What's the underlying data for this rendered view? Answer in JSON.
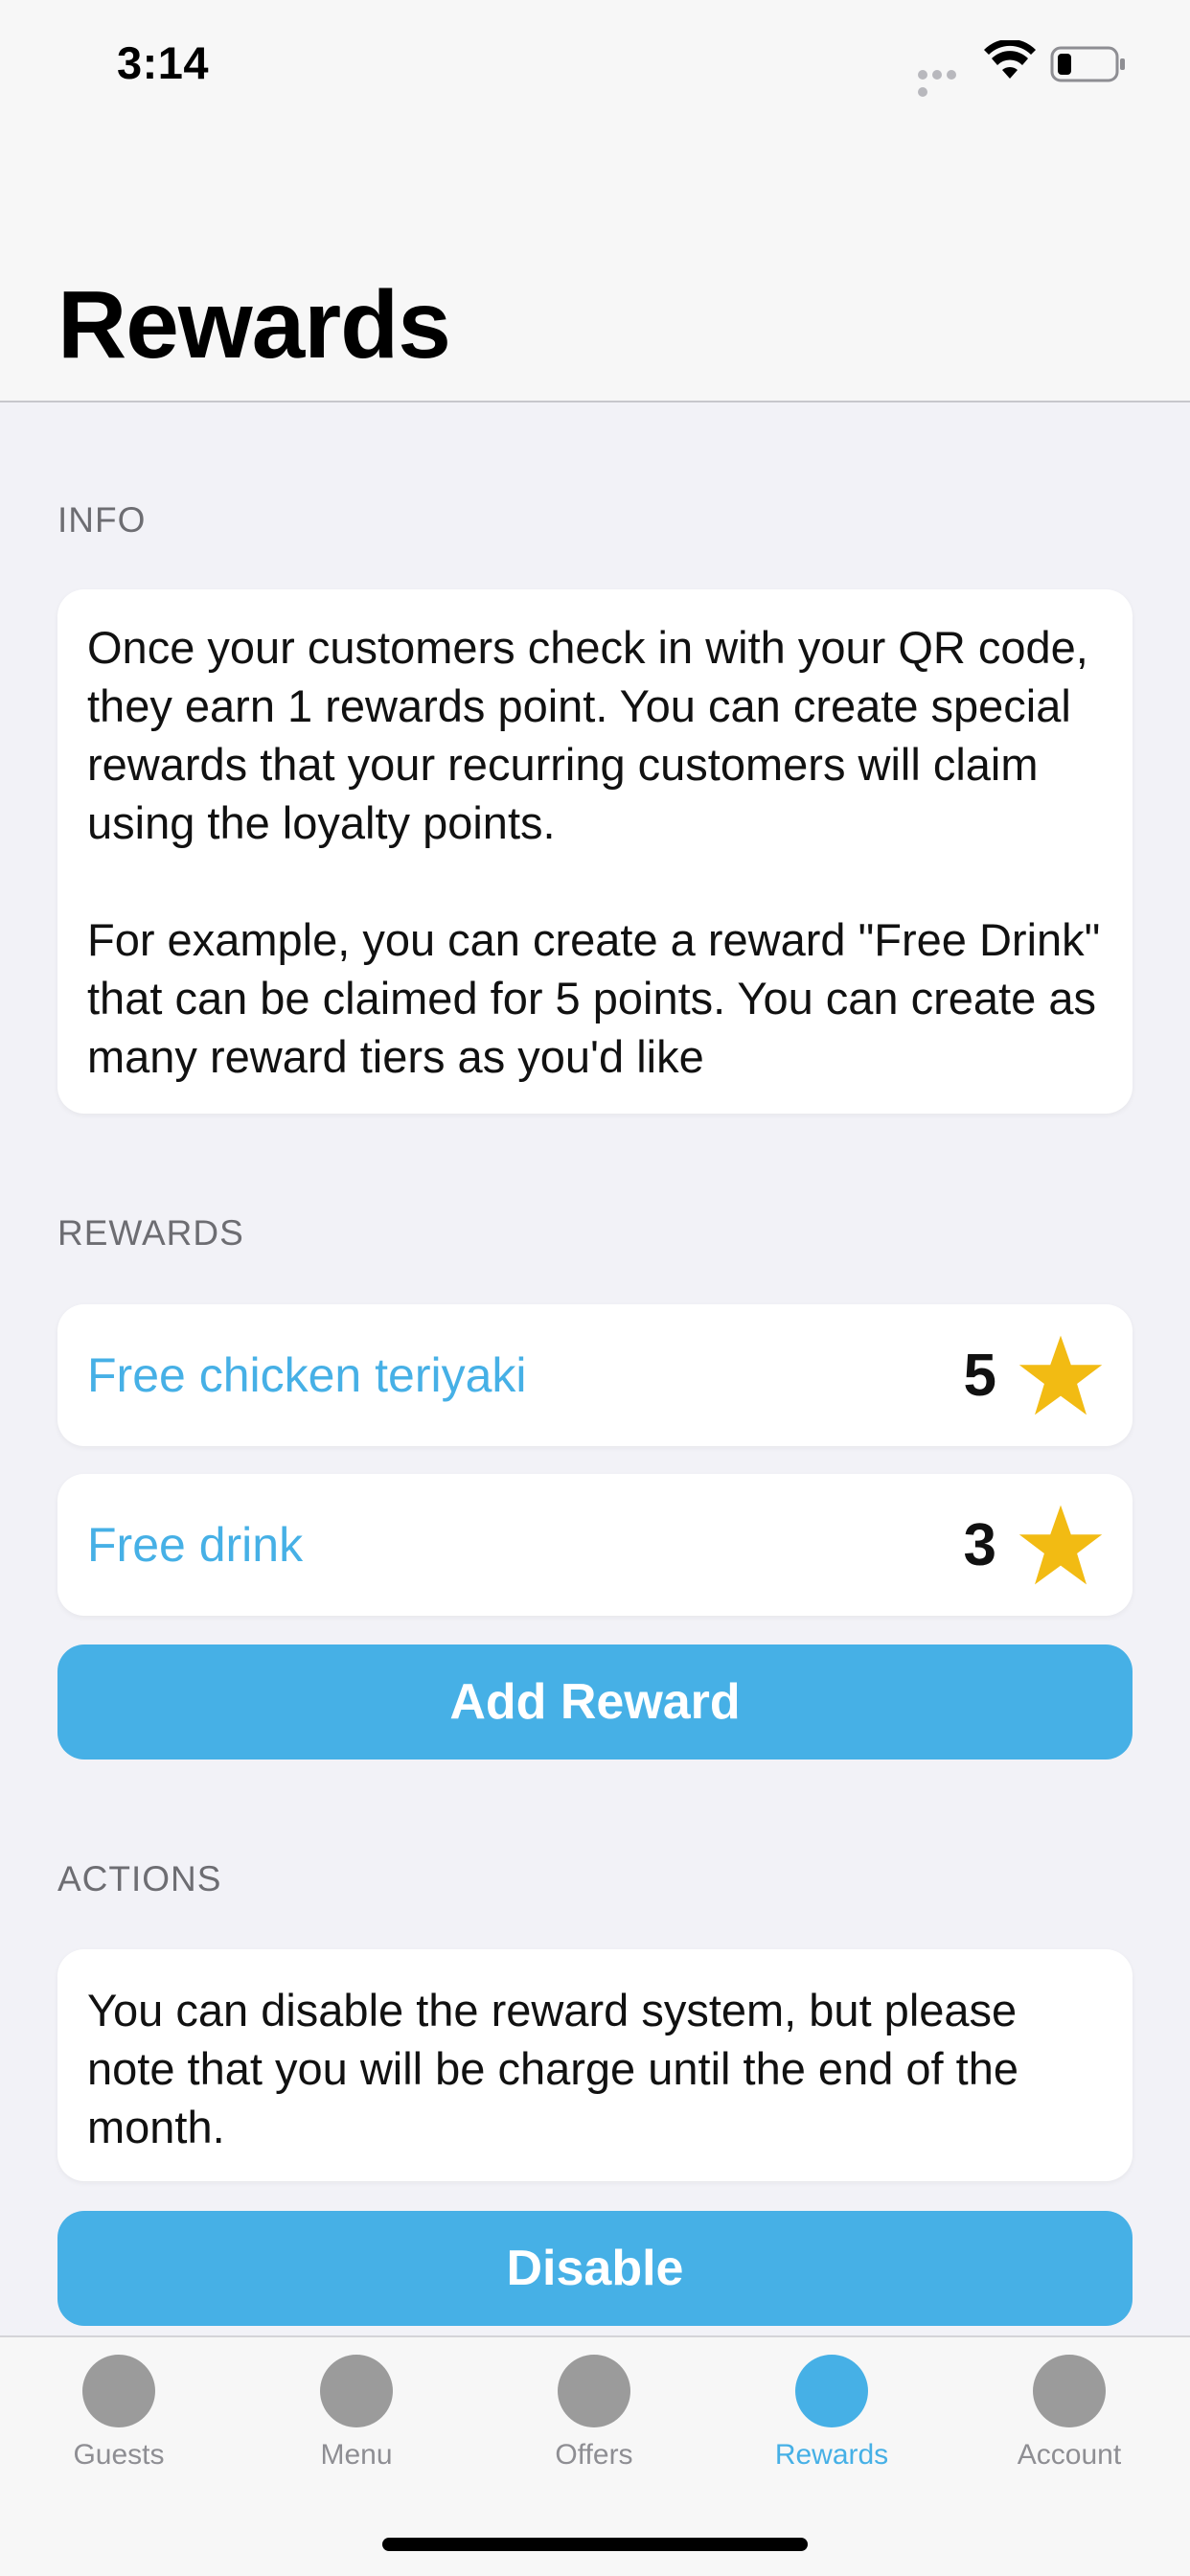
{
  "status_bar": {
    "time": "3:14"
  },
  "header": {
    "title": "Rewards"
  },
  "info": {
    "section_label": "INFO",
    "paragraph1": "Once your customers check in with your QR code, they earn 1 rewards point. You can create special rewards that your recurring customers will claim using the loyalty points.",
    "paragraph2": "For example, you can create a reward \"Free Drink\" that can be claimed for 5 points. You can create as many reward tiers as you'd like"
  },
  "rewards": {
    "section_label": "REWARDS",
    "items": [
      {
        "title": "Free chicken teriyaki",
        "points": "5"
      },
      {
        "title": "Free drink",
        "points": "3"
      }
    ],
    "add_button_label": "Add Reward"
  },
  "actions": {
    "section_label": "ACTIONS",
    "description": "You can disable the reward system, but please note that you will be charge until the end of the month.",
    "disable_button_label": "Disable"
  },
  "tab_bar": {
    "tabs": [
      {
        "label": "Guests"
      },
      {
        "label": "Menu"
      },
      {
        "label": "Offers"
      },
      {
        "label": "Rewards"
      },
      {
        "label": "Account"
      }
    ],
    "active_index": 3
  },
  "colors": {
    "accent": "#46b0e6",
    "star": "#f2bb13",
    "background": "#f2f2f7",
    "tab_inactive": "#9b9b9b"
  }
}
